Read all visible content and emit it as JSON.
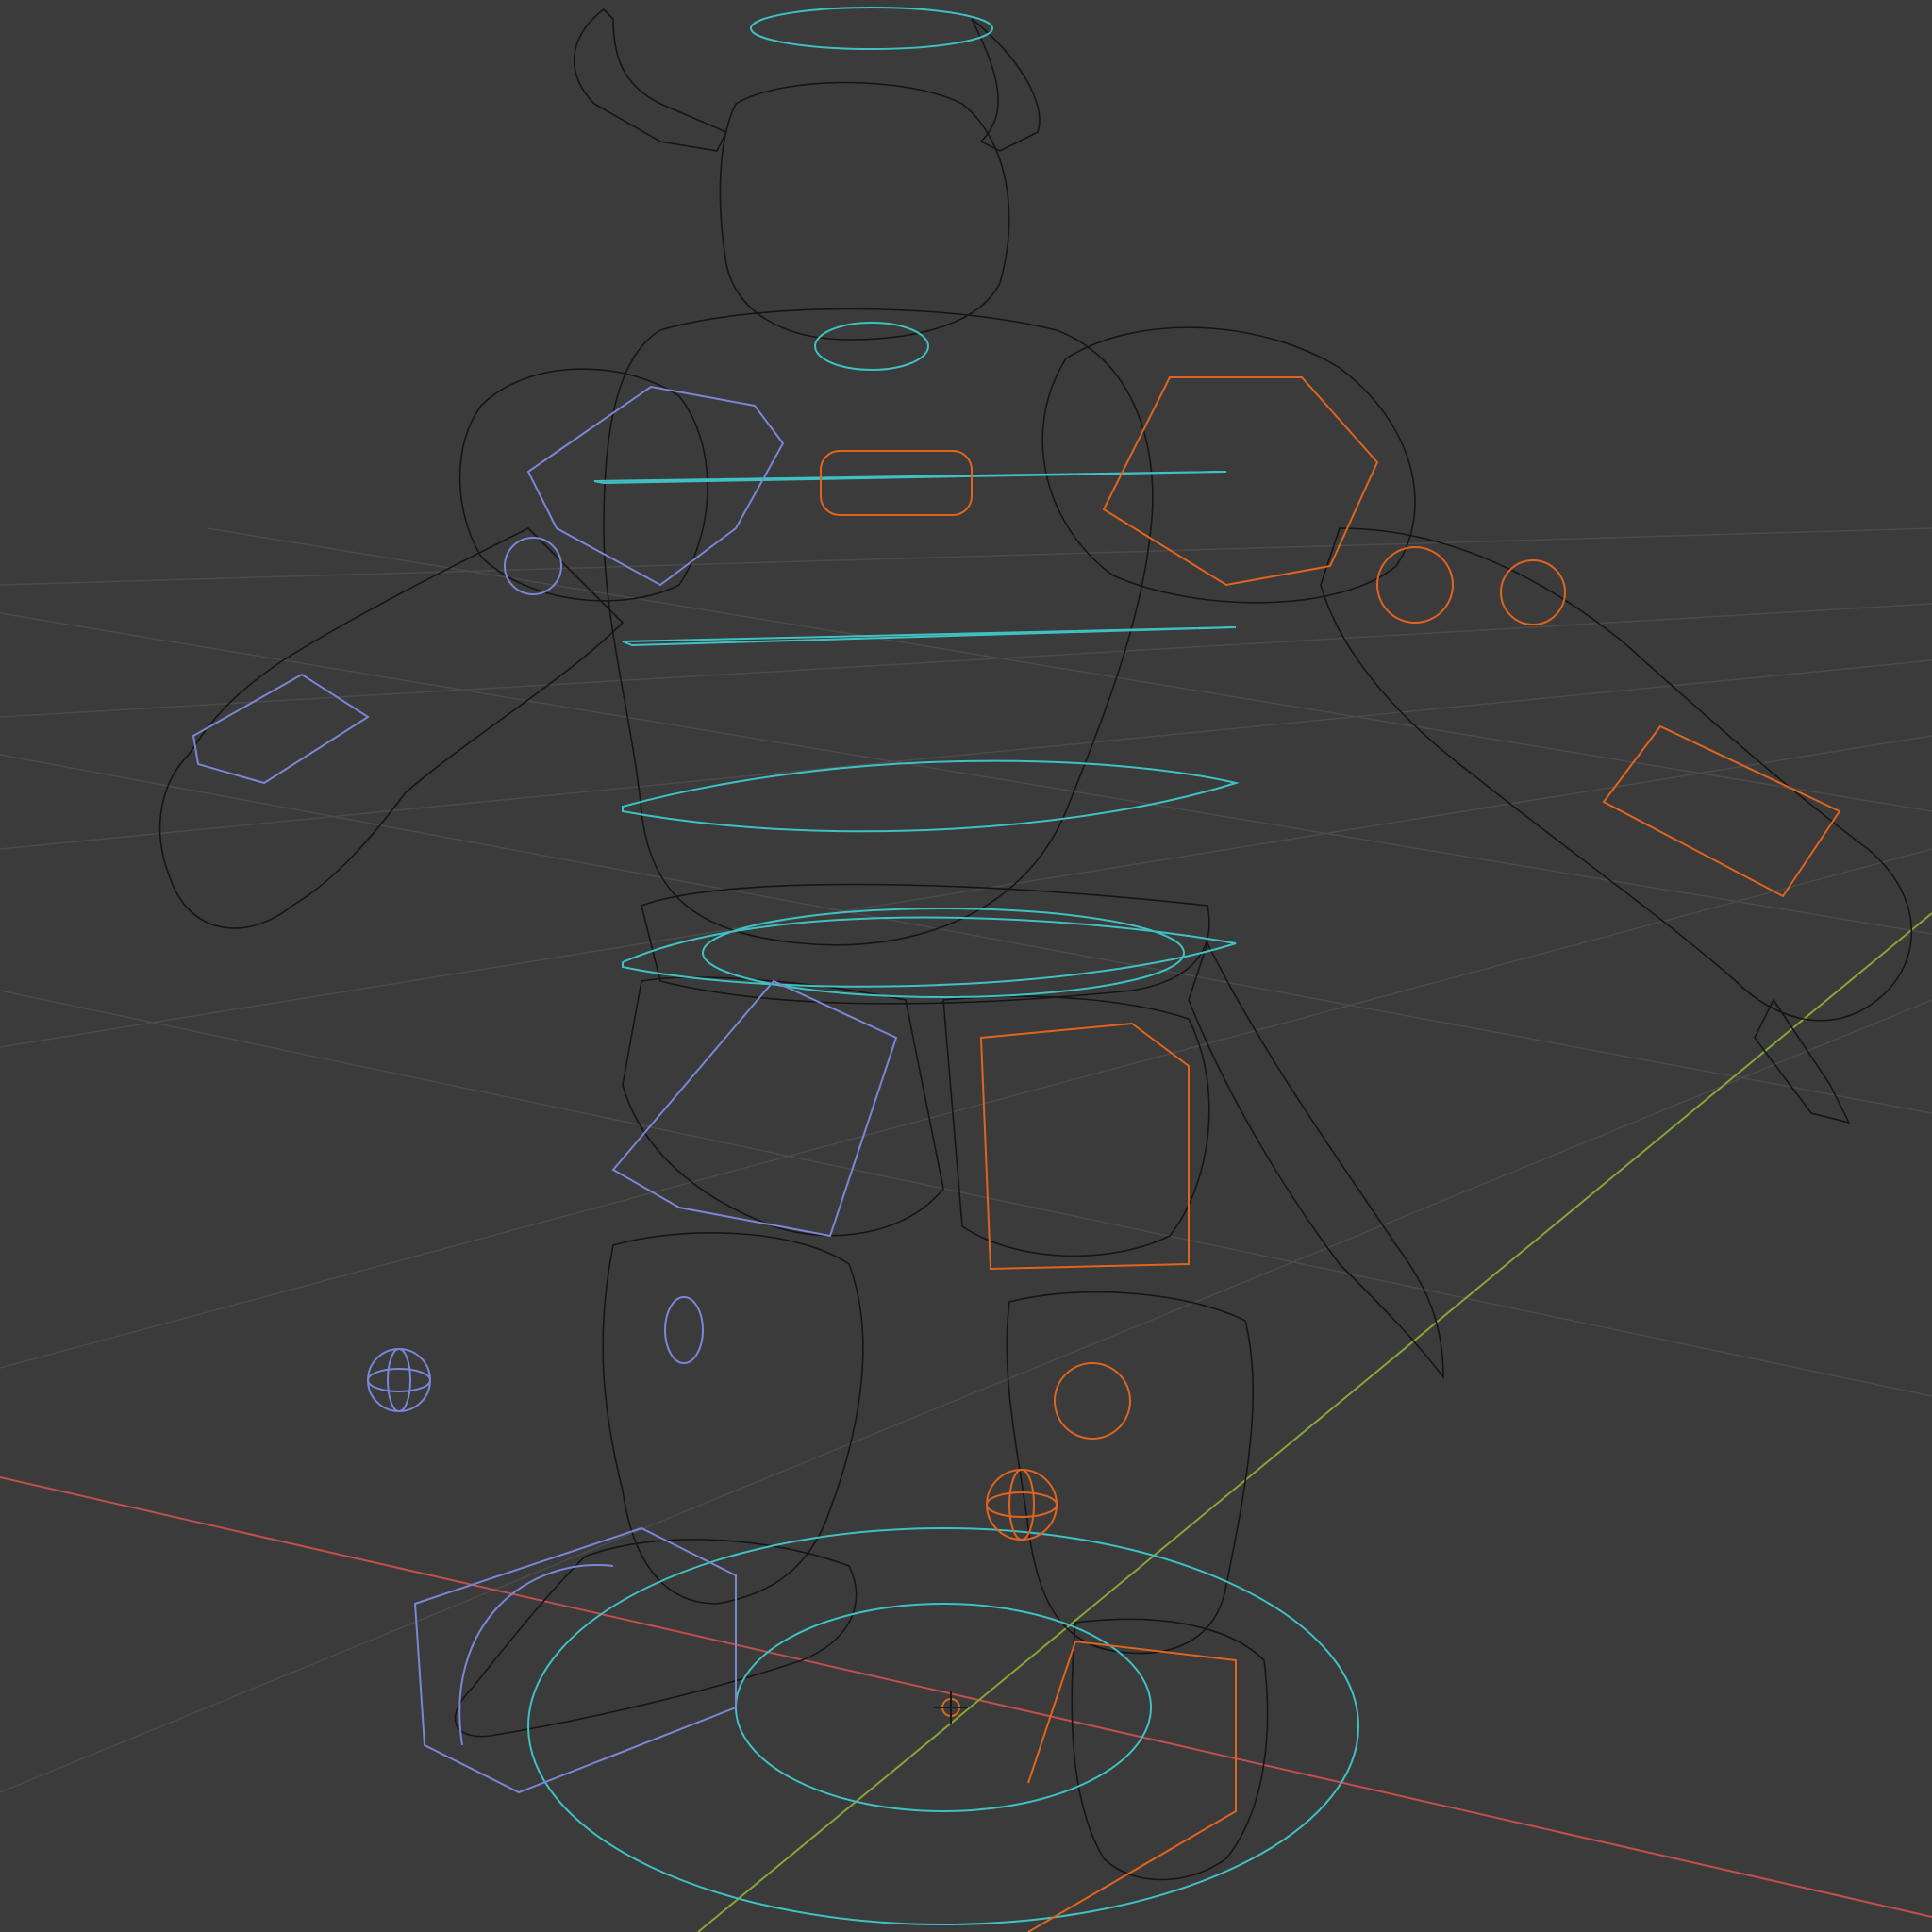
{
  "viewport": {
    "mode": "wireframe",
    "colors": {
      "background": "#3b3b3b",
      "grid": "#4a4a4a",
      "axis_x": "#c0504d",
      "axis_y": "#8aa436",
      "mesh": "#151515",
      "control_center": "#3fc1c4",
      "control_left": "#7b86d6",
      "control_right": "#e0641e"
    },
    "icons": [
      "3d-cursor-icon",
      "ik-target-sphere-icon"
    ]
  }
}
